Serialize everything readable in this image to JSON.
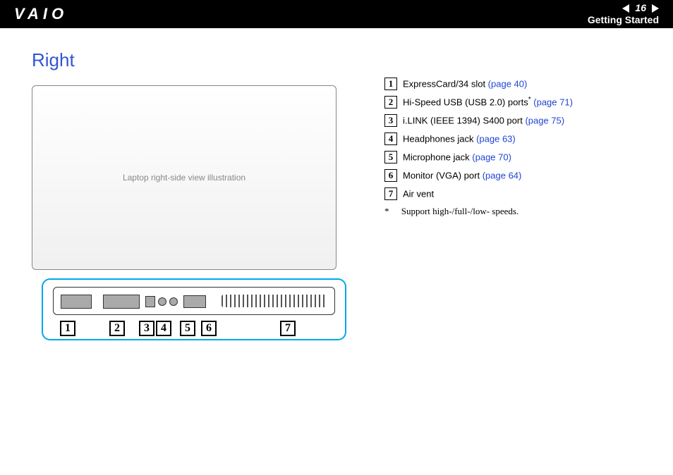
{
  "header": {
    "logo_text": "VAIO",
    "page_number": "16",
    "section_label": "Getting Started"
  },
  "title": "Right",
  "figure_alt": "Laptop right-side view illustration",
  "legend": [
    {
      "num": "1",
      "text": "ExpressCard/34 slot ",
      "page_ref": "(page 40)",
      "sup": ""
    },
    {
      "num": "2",
      "text": "Hi-Speed USB (USB 2.0) ports",
      "page_ref": "(page 71)",
      "sup": "*"
    },
    {
      "num": "3",
      "text": "i.LINK (IEEE 1394) S400 port ",
      "page_ref": "(page 75)",
      "sup": ""
    },
    {
      "num": "4",
      "text": "Headphones jack ",
      "page_ref": "(page 63)",
      "sup": ""
    },
    {
      "num": "5",
      "text": "Microphone jack ",
      "page_ref": "(page 70)",
      "sup": ""
    },
    {
      "num": "6",
      "text": "Monitor (VGA) port ",
      "page_ref": "(page 64)",
      "sup": ""
    },
    {
      "num": "7",
      "text": "Air vent",
      "page_ref": "",
      "sup": ""
    }
  ],
  "footnote": {
    "mark": "*",
    "text": "Support high-/full-/low- speeds."
  },
  "callouts": [
    "1",
    "2",
    "3",
    "4",
    "5",
    "6",
    "7"
  ]
}
